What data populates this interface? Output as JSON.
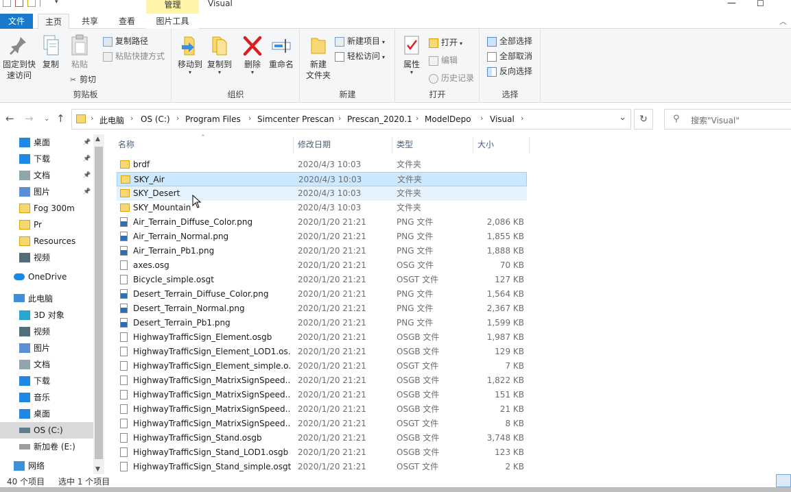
{
  "titlebar": {
    "manage_tab": "管理",
    "title": "Visual",
    "minimize": "—",
    "maximize": "☐"
  },
  "tabs": {
    "file": "文件",
    "home": "主页",
    "share": "共享",
    "view": "查看",
    "picture_tools": "图片工具"
  },
  "ribbon": {
    "clipboard": {
      "label": "剪贴板",
      "pin": "固定到快\n速访问",
      "copy": "复制",
      "paste": "粘贴",
      "copy_path": "复制路径",
      "paste_shortcut": "粘贴快捷方式",
      "cut": "剪切"
    },
    "organize": {
      "label": "组织",
      "move_to": "移动到",
      "copy_to": "复制到",
      "delete": "删除",
      "rename": "重命名"
    },
    "new": {
      "label": "新建",
      "new_folder": "新建\n文件夹",
      "new_item": "新建项目",
      "easy_access": "轻松访问"
    },
    "open": {
      "label": "打开",
      "properties": "属性",
      "open": "打开",
      "edit": "编辑",
      "history": "历史记录"
    },
    "select": {
      "label": "选择",
      "select_all": "全部选择",
      "select_none": "全部取消",
      "invert": "反向选择"
    }
  },
  "address": {
    "crumbs": [
      "此电脑",
      "OS (C:)",
      "Program Files",
      "Simcenter Prescan",
      "Prescan_2020.1",
      "ModelDepo",
      "Visual"
    ],
    "search_placeholder": "搜索\"Visual\""
  },
  "navpane": {
    "quick": [
      {
        "label": "桌面",
        "pinned": true
      },
      {
        "label": "下载",
        "pinned": true
      },
      {
        "label": "文档",
        "pinned": true
      },
      {
        "label": "图片",
        "pinned": true
      },
      {
        "label": "Fog 300m",
        "pinned": false
      },
      {
        "label": "Pr",
        "pinned": false
      },
      {
        "label": "Resources",
        "pinned": false
      },
      {
        "label": "视频",
        "pinned": false
      }
    ],
    "onedrive": "OneDrive",
    "thispc": "此电脑",
    "pc_items": [
      "3D 对象",
      "视频",
      "图片",
      "文档",
      "下载",
      "音乐",
      "桌面",
      "OS (C:)",
      "新加卷 (E:)"
    ],
    "network": "网络",
    "pin_glyph": "📌"
  },
  "columns": {
    "name": "名称",
    "date": "修改日期",
    "type": "类型",
    "size": "大小"
  },
  "files": [
    {
      "name": "brdf",
      "date": "2020/4/3 10:03",
      "type": "文件夹",
      "size": "",
      "kind": "folder"
    },
    {
      "name": "SKY_Air",
      "date": "2020/4/3 10:03",
      "type": "文件夹",
      "size": "",
      "kind": "folder"
    },
    {
      "name": "SKY_Desert",
      "date": "2020/4/3 10:03",
      "type": "文件夹",
      "size": "",
      "kind": "folder"
    },
    {
      "name": "SKY_Mountain",
      "date": "2020/4/3 10:03",
      "type": "文件夹",
      "size": "",
      "kind": "folder"
    },
    {
      "name": "Air_Terrain_Diffuse_Color.png",
      "date": "2020/1/20 21:21",
      "type": "PNG 文件",
      "size": "2,086 KB",
      "kind": "image"
    },
    {
      "name": "Air_Terrain_Normal.png",
      "date": "2020/1/20 21:21",
      "type": "PNG 文件",
      "size": "1,855 KB",
      "kind": "image"
    },
    {
      "name": "Air_Terrain_Pb1.png",
      "date": "2020/1/20 21:21",
      "type": "PNG 文件",
      "size": "1,888 KB",
      "kind": "image"
    },
    {
      "name": "axes.osg",
      "date": "2020/1/20 21:21",
      "type": "OSG 文件",
      "size": "70 KB",
      "kind": "file"
    },
    {
      "name": "Bicycle_simple.osgt",
      "date": "2020/1/20 21:21",
      "type": "OSGT 文件",
      "size": "127 KB",
      "kind": "file"
    },
    {
      "name": "Desert_Terrain_Diffuse_Color.png",
      "date": "2020/1/20 21:21",
      "type": "PNG 文件",
      "size": "1,564 KB",
      "kind": "image"
    },
    {
      "name": "Desert_Terrain_Normal.png",
      "date": "2020/1/20 21:21",
      "type": "PNG 文件",
      "size": "2,367 KB",
      "kind": "image"
    },
    {
      "name": "Desert_Terrain_Pb1.png",
      "date": "2020/1/20 21:21",
      "type": "PNG 文件",
      "size": "1,599 KB",
      "kind": "image"
    },
    {
      "name": "HighwayTrafficSign_Element.osgb",
      "date": "2020/1/20 21:21",
      "type": "OSGB 文件",
      "size": "1,987 KB",
      "kind": "file"
    },
    {
      "name": "HighwayTrafficSign_Element_LOD1.os...",
      "date": "2020/1/20 21:21",
      "type": "OSGB 文件",
      "size": "129 KB",
      "kind": "file"
    },
    {
      "name": "HighwayTrafficSign_Element_simple.o...",
      "date": "2020/1/20 21:21",
      "type": "OSGT 文件",
      "size": "7 KB",
      "kind": "file"
    },
    {
      "name": "HighwayTrafficSign_MatrixSignSpeed....",
      "date": "2020/1/20 21:21",
      "type": "OSGB 文件",
      "size": "1,822 KB",
      "kind": "file"
    },
    {
      "name": "HighwayTrafficSign_MatrixSignSpeed...",
      "date": "2020/1/20 21:21",
      "type": "OSGB 文件",
      "size": "151 KB",
      "kind": "file"
    },
    {
      "name": "HighwayTrafficSign_MatrixSignSpeed...",
      "date": "2020/1/20 21:21",
      "type": "OSGB 文件",
      "size": "21 KB",
      "kind": "file"
    },
    {
      "name": "HighwayTrafficSign_MatrixSignSpeed...",
      "date": "2020/1/20 21:21",
      "type": "OSGT 文件",
      "size": "8 KB",
      "kind": "file"
    },
    {
      "name": "HighwayTrafficSign_Stand.osgb",
      "date": "2020/1/20 21:21",
      "type": "OSGB 文件",
      "size": "3,748 KB",
      "kind": "file"
    },
    {
      "name": "HighwayTrafficSign_Stand_LOD1.osgb",
      "date": "2020/1/20 21:21",
      "type": "OSGB 文件",
      "size": "123 KB",
      "kind": "file"
    },
    {
      "name": "HighwayTrafficSign_Stand_simple.osgt",
      "date": "2020/1/20 21:21",
      "type": "OSGT 文件",
      "size": "2 KB",
      "kind": "file"
    }
  ],
  "selected_index": 1,
  "hover_index": 2,
  "status": {
    "count": "40 个项目",
    "selected": "选中 1 个项目"
  },
  "colors": {
    "accent": "#1979ca",
    "selection": "#cce8ff",
    "folder": "#f8d775"
  }
}
